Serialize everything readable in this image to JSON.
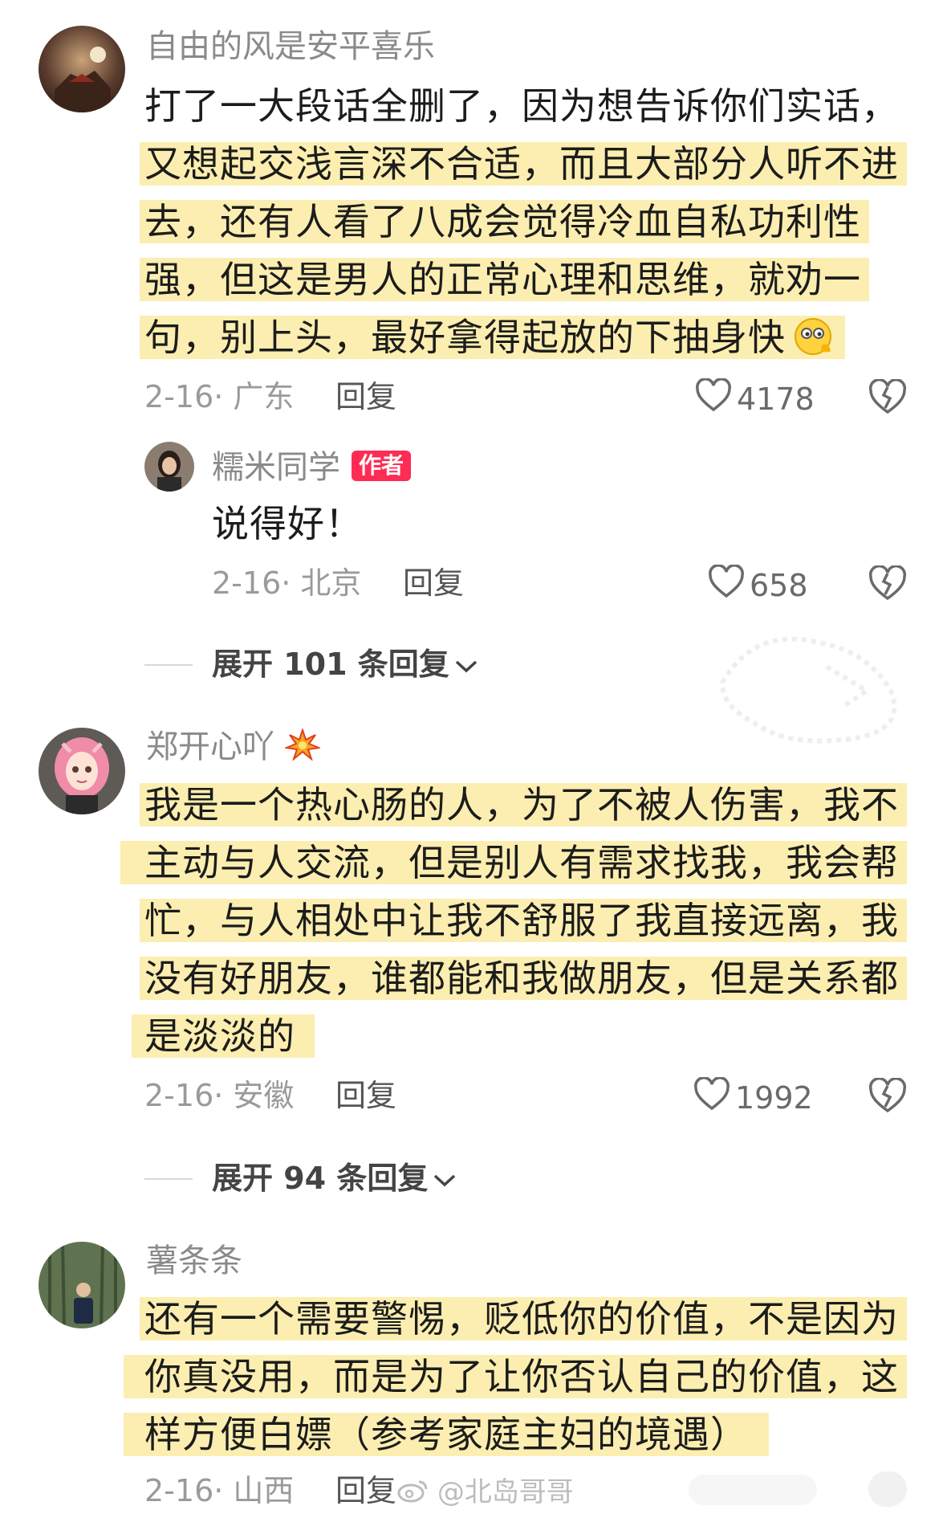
{
  "comments": [
    {
      "username": "自由的风是安平喜乐",
      "lines": [
        "打了一大段话全删了，因为想告诉你们实话，",
        "又想起交浅言深不合适，而且大部分人听不进",
        "去，还有人看了八成会觉得冷血自私功利性",
        "强，但这是男人的正常心理和思维，就劝一",
        "句，别上头，最好拿得起放的下抽身快"
      ],
      "date_location": "2-16· 广东",
      "reply_label": "回复",
      "likes": "4178"
    },
    {
      "username": "郑开心吖",
      "lines": [
        "我是一个热心肠的人，为了不被人伤害，我不",
        "主动与人交流，但是别人有需求找我，我会帮",
        "忙，与人相处中让我不舒服了我直接远离，我",
        "没有好朋友，谁都能和我做朋友，但是关系都",
        "是淡淡的"
      ],
      "date_location": "2-16· 安徽",
      "reply_label": "回复",
      "likes": "1992"
    },
    {
      "username": "薯条条",
      "lines": [
        "还有一个需要警惕，贬低你的价值，不是因为",
        "你真没用，而是为了让你否认自己的价值，这",
        "样方便白嫖（参考家庭主妇的境遇）"
      ],
      "date_location": "2-16· 山西",
      "reply_label": "回复"
    }
  ],
  "author_reply": {
    "username": "糯米同学",
    "badge": "作者",
    "text": "说得好！",
    "date_location": "2-16· 北京",
    "reply_label": "回复",
    "likes": "658"
  },
  "expand_1": "展开 101 条回复",
  "expand_2": "展开 94 条回复",
  "watermark": "@北岛哥哥",
  "icons": {
    "like": "heart-outline-icon",
    "dislike": "broken-heart-icon",
    "expand": "chevron-down-icon",
    "emoji": "thinking-emoji-icon",
    "username_decor": "explosion-emoji-icon"
  },
  "colors": {
    "highlight": "#fbeeb0",
    "badge": "#fe2c55",
    "username": "#8a8a8a"
  }
}
